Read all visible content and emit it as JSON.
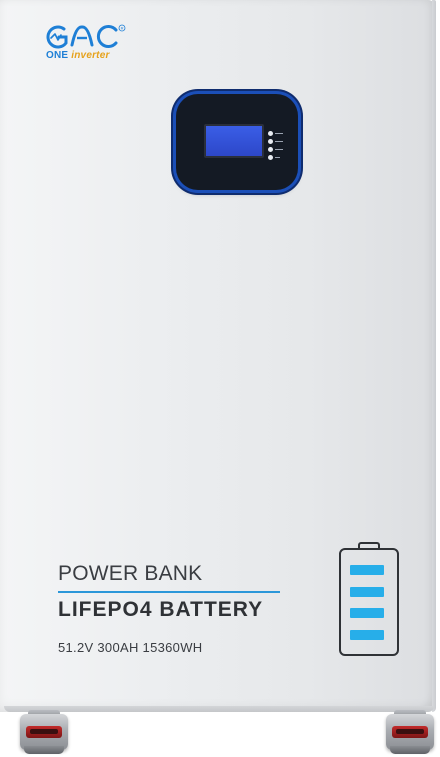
{
  "logo": {
    "mark_text": "GAC",
    "registered": "®",
    "brand_one": "ONE",
    "brand_inverter": "inverter",
    "mark_color": "#1e7fd6",
    "accent_color": "#e6a21c"
  },
  "display": {
    "lcd_color": "#3a5ee6",
    "ring_color": "#1b4fb8",
    "indicator_count": 4,
    "icon": "lcd-screen-icon"
  },
  "labels": {
    "power_bank": "POWER BANK",
    "battery_type": "LIFEPO4 BATTERY",
    "spec": "51.2V 300AH 15360WH"
  },
  "battery_icon": {
    "icon": "battery-icon",
    "bars": 4,
    "bar_color": "#27aee9"
  },
  "colors": {
    "cabinet": "#eceef0",
    "divider": "#2b97d9",
    "text": "#3a3d42",
    "foot_accent": "#c22b2b"
  }
}
